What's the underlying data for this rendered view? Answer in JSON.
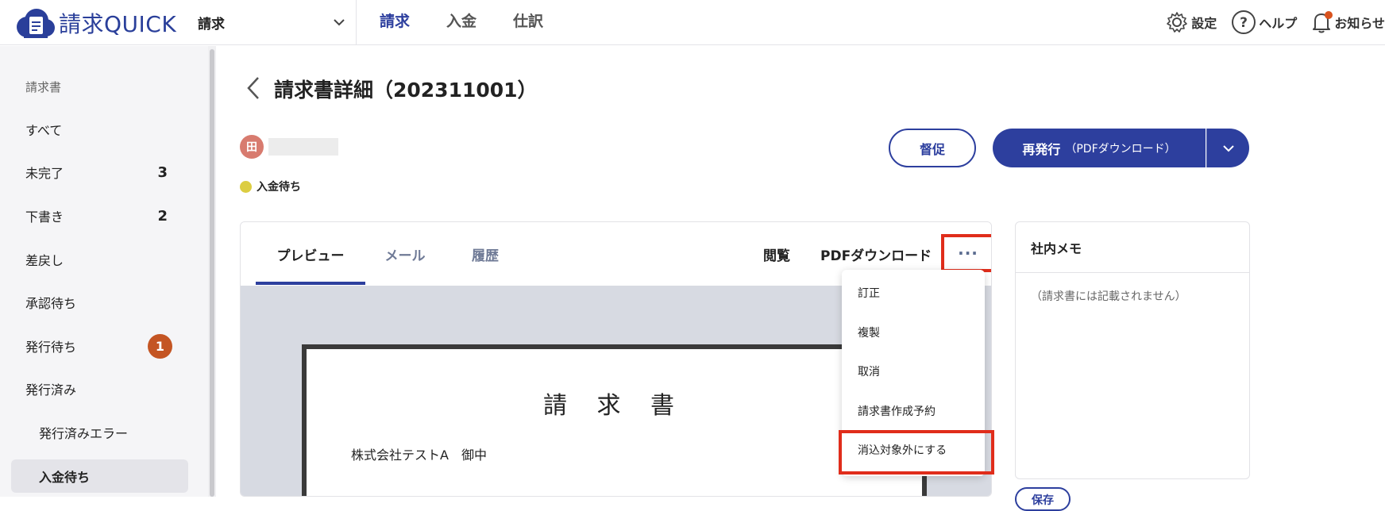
{
  "app": {
    "name": "請求QUICK"
  },
  "header": {
    "service_select": "請求",
    "nav": [
      "請求",
      "入金",
      "仕訳"
    ],
    "settings": "設定",
    "help": "ヘルプ",
    "notifications": "お知らせ"
  },
  "sidebar": {
    "section": "請求書",
    "items": [
      {
        "label": "すべて"
      },
      {
        "label": "未完了",
        "count": "3"
      },
      {
        "label": "下書き",
        "count": "2"
      },
      {
        "label": "差戻し"
      },
      {
        "label": "承認待ち"
      },
      {
        "label": "発行待ち",
        "badge": "1"
      },
      {
        "label": "発行済み"
      },
      {
        "label": "発行済みエラー"
      },
      {
        "label": "入金待ち"
      }
    ]
  },
  "page": {
    "title": "請求書詳細（202311001）",
    "avatar": "田",
    "status": "入金待ち",
    "remind_button": "督促",
    "reissue_button": "再発行",
    "reissue_sub": "（PDFダウンロード）"
  },
  "preview": {
    "tabs": [
      "プレビュー",
      "メール",
      "履歴"
    ],
    "view": "閲覧",
    "pdf_download": "PDFダウンロード",
    "more": "···",
    "doc_title": "請 求 書",
    "doc_to": "株式会社テストA　御中"
  },
  "menu": {
    "items": [
      "訂正",
      "複製",
      "取消",
      "請求書作成予約",
      "消込対象外にする"
    ]
  },
  "memo": {
    "title": "社内メモ",
    "placeholder": "（請求書には記載されません）",
    "save": "保存"
  },
  "colors": {
    "brand": "#2d3f9e",
    "highlight": "#e02d1b",
    "status_dot": "#dccd42",
    "badge": "#c45523"
  }
}
